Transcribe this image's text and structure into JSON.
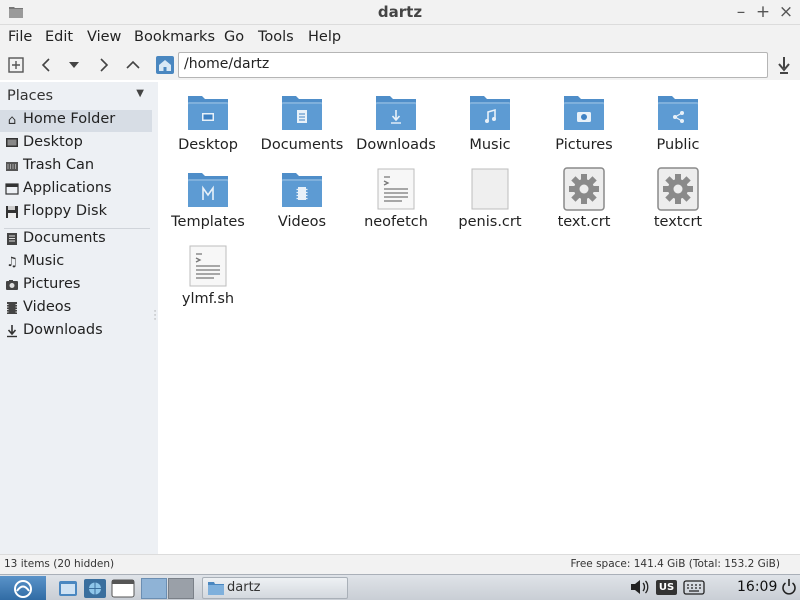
{
  "window": {
    "title": "dartz",
    "controls": {
      "minimize": "–",
      "maximize": "+",
      "close": "×"
    }
  },
  "menu": [
    "File",
    "Edit",
    "View",
    "Bookmarks",
    "Go",
    "Tools",
    "Help"
  ],
  "toolbar": {
    "path": "/home/dartz",
    "icons": [
      "new-tab-icon",
      "back-icon",
      "history-dropdown-icon",
      "forward-icon",
      "up-icon",
      "home-icon",
      "go-icon"
    ]
  },
  "sidebar": {
    "header": "Places",
    "places": [
      {
        "label": "Home Folder",
        "icon": "home-icon",
        "selected": true
      },
      {
        "label": "Desktop",
        "icon": "desktop-icon"
      },
      {
        "label": "Trash Can",
        "icon": "trash-icon"
      },
      {
        "label": "Applications",
        "icon": "applications-icon"
      },
      {
        "label": "Floppy Disk",
        "icon": "floppy-icon"
      }
    ],
    "bookmarks": [
      {
        "label": "Documents",
        "icon": "documents-icon"
      },
      {
        "label": "Music",
        "icon": "music-icon"
      },
      {
        "label": "Pictures",
        "icon": "pictures-icon"
      },
      {
        "label": "Videos",
        "icon": "videos-icon"
      },
      {
        "label": "Downloads",
        "icon": "downloads-icon"
      }
    ]
  },
  "files": [
    {
      "name": "Desktop",
      "type": "folder",
      "emblem": "desktop"
    },
    {
      "name": "Documents",
      "type": "folder",
      "emblem": "document"
    },
    {
      "name": "Downloads",
      "type": "folder",
      "emblem": "download"
    },
    {
      "name": "Music",
      "type": "folder",
      "emblem": "music"
    },
    {
      "name": "Pictures",
      "type": "folder",
      "emblem": "camera"
    },
    {
      "name": "Public",
      "type": "folder",
      "emblem": "share"
    },
    {
      "name": "Templates",
      "type": "folder",
      "emblem": "template"
    },
    {
      "name": "Videos",
      "type": "folder",
      "emblem": "film"
    },
    {
      "name": "neofetch",
      "type": "text"
    },
    {
      "name": "penis.crt",
      "type": "blank"
    },
    {
      "name": "text.crt",
      "type": "gear"
    },
    {
      "name": "textcrt",
      "type": "gear"
    },
    {
      "name": "ylmf.sh",
      "type": "text"
    }
  ],
  "status": {
    "left": "13 items (20 hidden)",
    "right": "Free space: 141.4 GiB (Total: 153.2 GiB)"
  },
  "taskbar": {
    "task_label": "dartz",
    "keyboard_layout": "US",
    "clock": "16:09"
  },
  "colors": {
    "folder_top": "#7fb0dc",
    "folder_body": "#3f82c4",
    "selection": "#d7dde5",
    "sidebar_bg": "#edf0f4"
  }
}
